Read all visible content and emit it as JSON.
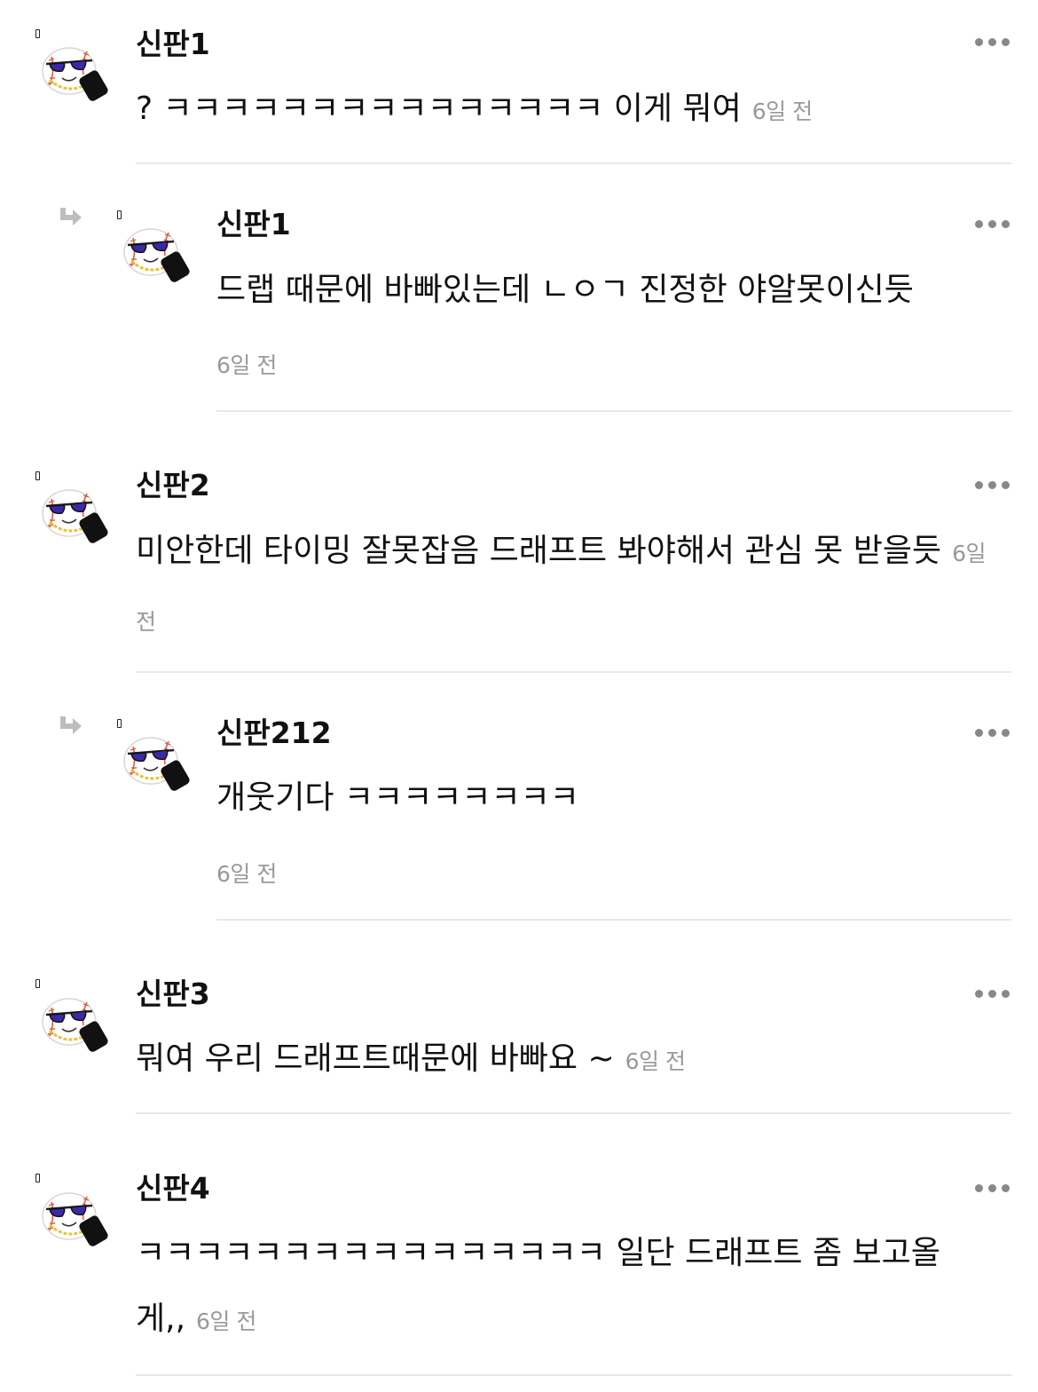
{
  "comments": [
    {
      "author": "신판1",
      "text": "? ㅋㅋㅋㅋㅋㅋㅋㅋㅋㅋㅋㅋㅋㅋㅋ 이게 뭐여",
      "time": "6일 전"
    },
    {
      "author": "신판1",
      "text": "드랩 때문에 바빠있는데 ㄴㅇㄱ 진정한 야알못이신듯",
      "time": "6일 전"
    },
    {
      "author": "신판2",
      "text": "미안한데 타이밍 잘못잡음 드래프트 봐야해서 관심 못 받을듯",
      "time": "6일 전"
    },
    {
      "author": "신판212",
      "text": "개웃기다 ㅋㅋㅋㅋㅋㅋㅋㅋ",
      "time": "6일 전"
    },
    {
      "author": "신판3",
      "text": "뭐여 우리 드래프트때문에 바빠요 ~",
      "time": "6일 전"
    },
    {
      "author": "신판4",
      "text": "ㅋㅋㅋㅋㅋㅋㅋㅋㅋㅋㅋㅋㅋㅋㅋㅋ 일단 드래프트 좀 보고올게,,",
      "time": "6일 전"
    }
  ],
  "icons": {
    "avatar": "baseball-sunglasses-avatar-icon",
    "reply": "reply-arrow-icon",
    "more": "more-options-icon",
    "marker": "level-marker-icon"
  },
  "colors": {
    "text": "#111111",
    "timestamp": "#999999",
    "divider": "#e8e8e8",
    "more_dots": "#888888",
    "reply_arrow": "#bdbdbd"
  }
}
